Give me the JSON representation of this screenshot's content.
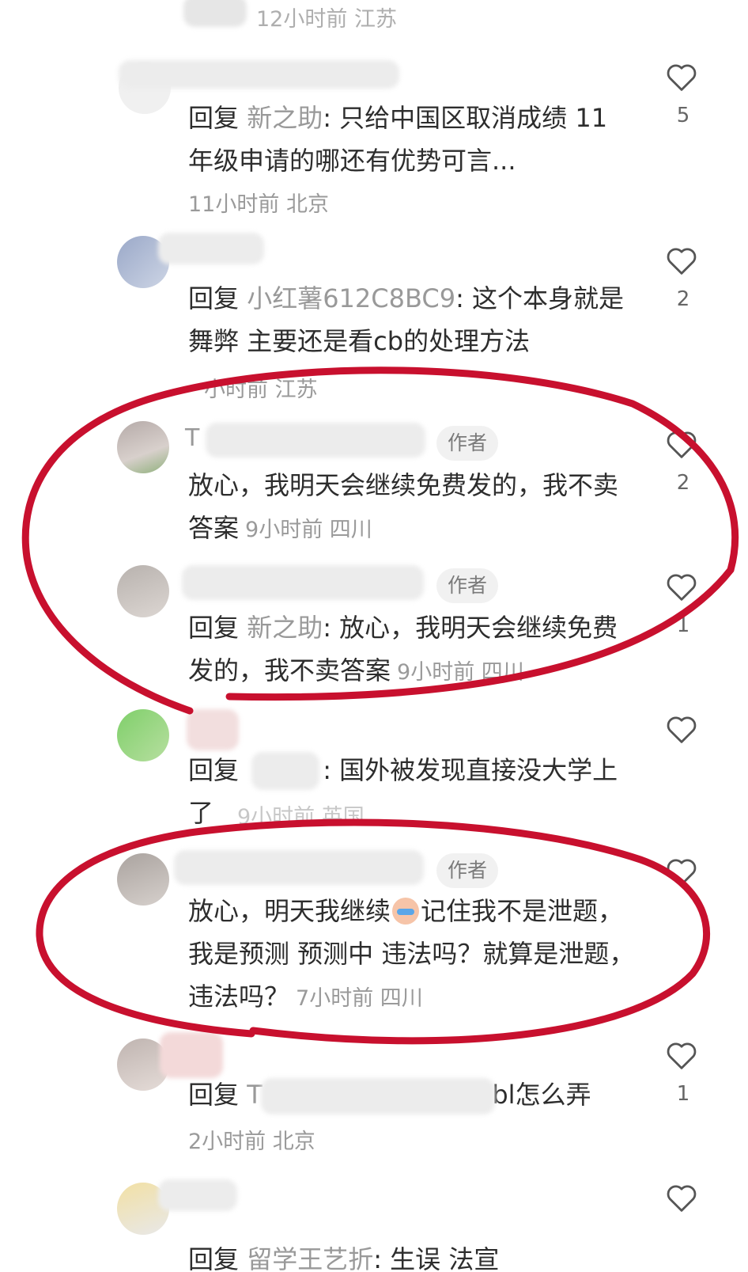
{
  "strings": {
    "reply_word": "回复",
    "author_badge": "作者",
    "heart_icon": "heart-outline-icon",
    "cry_emoji": "crying-face-emoji"
  },
  "colors": {
    "annotation_red": "#c8102e",
    "meta_gray": "#9a9a9a",
    "text_dark": "#2d2d2d",
    "badge_bg": "#f1f1f1"
  },
  "comments": [
    {
      "meta": "12小时前 江苏"
    },
    {
      "reply_to": "新之助",
      "text": "只给中国区取消成绩 11年级申请的哪还有优势可言...",
      "meta": "11小时前 北京",
      "likes": "5"
    },
    {
      "reply_to": "小红薯612C8BC9",
      "text": "这个本身就是舞弊 主要还是看cb的处理方法",
      "meta": "小时前 江苏",
      "likes": "2"
    },
    {
      "name_fragment": "T",
      "badge": "作者",
      "text": "放心，我明天会继续免费发的，我不卖答案",
      "meta": "9小时前 四川",
      "likes": "2"
    },
    {
      "badge": "作者",
      "reply_to": "新之助",
      "text": "放心，我明天会继续免费发的，我不卖答案",
      "meta": "9小时前 四川",
      "likes": "1"
    },
    {
      "reply_to_fragment": "",
      "text": "国外被发现直接没大学上了",
      "meta": "9小时前 英国",
      "likes": ""
    },
    {
      "badge": "作者",
      "text_part1": "放心，明天我继续",
      "text_part2": "记住我不是泄题，我是预测 预测中 违法吗？就算是泄题，违法吗？",
      "meta": "7小时前 四川",
      "likes": ""
    },
    {
      "reply_to_fragment": "T",
      "text": "bl怎么弄",
      "meta": "2小时前 北京",
      "likes": "1"
    },
    {
      "reply_to_fragment": "留学王艺折",
      "text": "生误 法宣"
    }
  ]
}
